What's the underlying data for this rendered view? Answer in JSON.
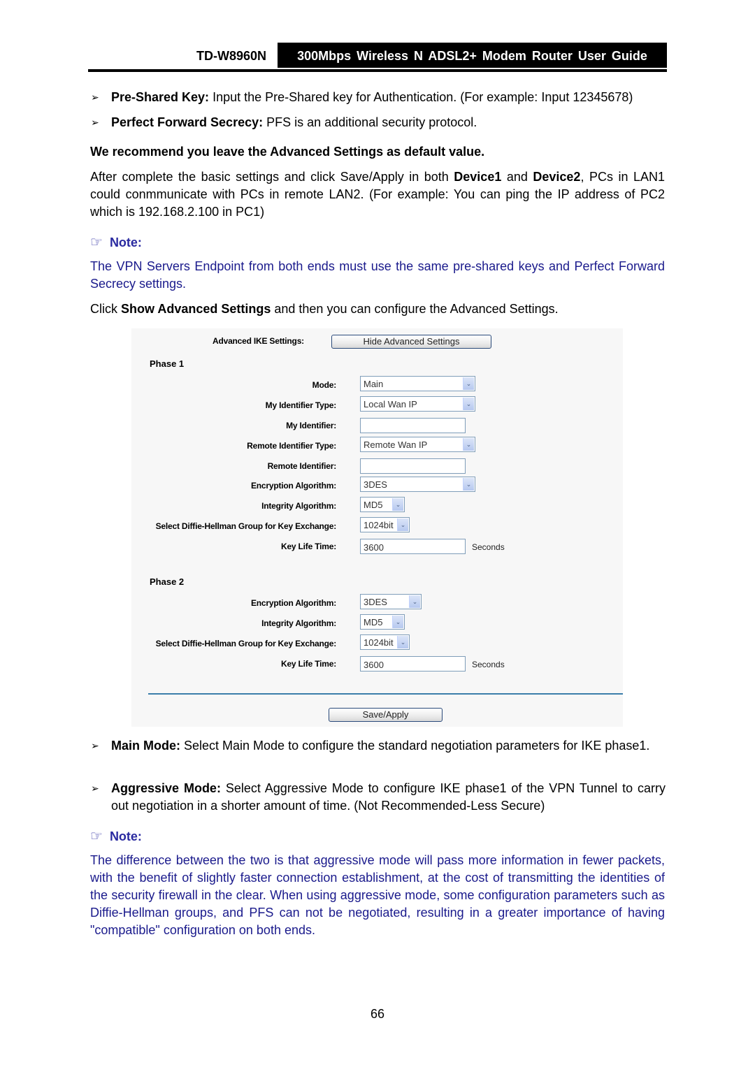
{
  "header": {
    "model": "TD-W8960N",
    "title": "300Mbps Wireless N ADSL2+ Modem Router User Guide"
  },
  "bullets_top": [
    {
      "term": "Pre-Shared Key:",
      "text": " Input the Pre-Shared key for Authentication. (For example: Input 12345678)"
    },
    {
      "term": "Perfect Forward Secrecy:",
      "text": " PFS is an additional security protocol."
    }
  ],
  "recommend": "We recommend you leave the Advanced Settings as default value.",
  "after_para": {
    "part1": "After complete the basic settings and click Save/Apply in both ",
    "device1": "Device1",
    "part2": " and ",
    "device2": "Device2",
    "part3": ", PCs in LAN1 could conmmunicate with PCs in remote LAN2. (For example: You can ping the IP address of PC2 which is 192.168.2.100 in PC1)"
  },
  "note1": {
    "icon": "pointing-hand-icon",
    "label": "Note:",
    "text": "The VPN Servers Endpoint from both ends must use the same pre-shared keys and Perfect Forward Secrecy settings."
  },
  "click_para": {
    "part1": "Click ",
    "bold": "Show Advanced Settings",
    "part2": " and then you can configure the Advanced Settings."
  },
  "screenshot": {
    "advanced_label": "Advanced IKE Settings:",
    "hide_button": "Hide Advanced Settings",
    "phase1": {
      "title": "Phase 1",
      "mode_label": "Mode:",
      "mode_value": "Main",
      "my_id_type_label": "My Identifier Type:",
      "my_id_type_value": "Local Wan IP",
      "my_id_label": "My Identifier:",
      "my_id_value": "",
      "remote_id_type_label": "Remote Identifier Type:",
      "remote_id_type_value": "Remote Wan IP",
      "remote_id_label": "Remote Identifier:",
      "remote_id_value": "",
      "enc_label": "Encryption Algorithm:",
      "enc_value": "3DES",
      "integ_label": "Integrity Algorithm:",
      "integ_value": "MD5",
      "dh_label": "Select Diffie-Hellman Group for Key Exchange:",
      "dh_value": "1024bit",
      "klt_label": "Key Life Time:",
      "klt_value": "3600",
      "klt_unit": "Seconds"
    },
    "phase2": {
      "title": "Phase 2",
      "enc_label": "Encryption Algorithm:",
      "enc_value": "3DES",
      "integ_label": "Integrity Algorithm:",
      "integ_value": "MD5",
      "dh_label": "Select Diffie-Hellman Group for Key Exchange:",
      "dh_value": "1024bit",
      "klt_label": "Key Life Time:",
      "klt_value": "3600",
      "klt_unit": "Seconds"
    },
    "save_button": "Save/Apply",
    "dropdown_glyph": "⌄"
  },
  "bullets_bottom": [
    {
      "term": "Main Mode:",
      "text": " Select Main Mode to configure the standard negotiation parameters for IKE phase1."
    },
    {
      "term": "Aggressive Mode:",
      "text": " Select Aggressive Mode to configure IKE phase1 of the VPN Tunnel to carry out negotiation in a shorter amount of time. (Not Recommended-Less Secure)"
    }
  ],
  "note2": {
    "icon": "pointing-hand-icon",
    "label": "Note:",
    "text": "The difference between the two is that aggressive mode will pass more information in fewer packets, with the benefit of slightly faster connection establishment, at the cost of transmitting the identities of the security firewall in the clear. When using aggressive mode, some configuration parameters such as Diffie-Hellman groups, and PFS can not be negotiated, resulting in a greater importance of having \"compatible\" configuration on both ends."
  },
  "bullet_glyph": "➢",
  "hand_glyph": "☞",
  "page_number": "66"
}
